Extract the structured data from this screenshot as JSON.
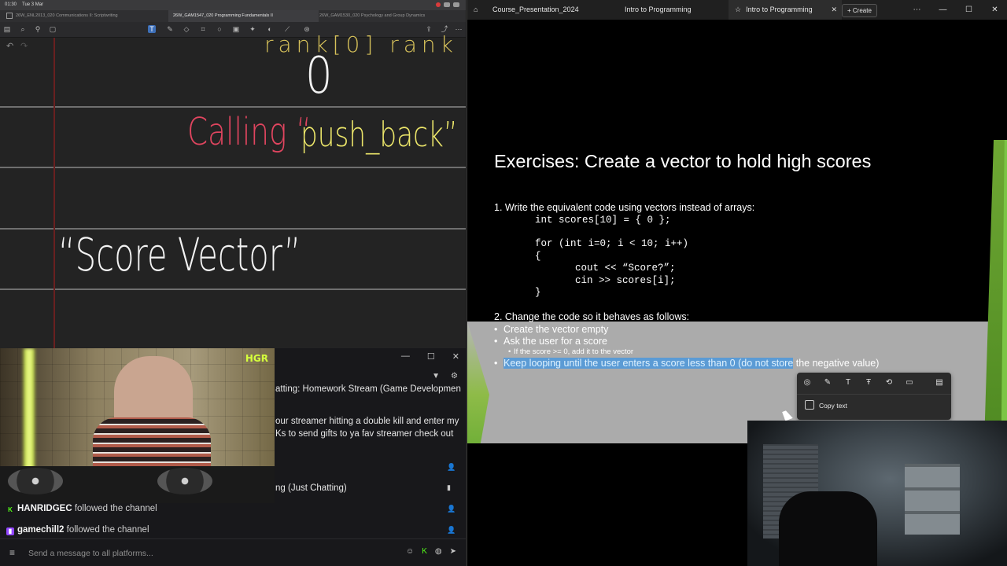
{
  "ipad": {
    "status_time": "01:30",
    "status_date": "Tue 3 Mar",
    "tabs": [
      {
        "label": "26W_ENL2013_020 Communications II: Scriptwriting"
      },
      {
        "label": "26W_GAM1547_020 Programming Fundamentals II"
      },
      {
        "label": "26W_GAM1530_020 Psychology and Group Dynamics"
      }
    ],
    "handwriting": {
      "top_partial": "rank[0] rank",
      "zero": "0",
      "calling": "Calling “",
      "push_back": "push_back”",
      "score_vector": "“Score Vector”"
    }
  },
  "chat": {
    "lines": [
      {
        "text": "atting: Homework Stream (Game Development)"
      },
      {
        "text": "our streamer hitting a double kill and enter my"
      },
      {
        "text": "Ks to send gifts to ya fav streamer check out"
      },
      {
        "text": "ng (Just Chatting)"
      }
    ],
    "follows": [
      {
        "platform": "kick",
        "user": "HANRIDGEC",
        "text": "followed the channel"
      },
      {
        "platform": "twitch",
        "user": "gamechill2",
        "text": "followed the channel"
      }
    ],
    "input_placeholder": "Send a message to all platforms...",
    "cam_logo": "HGR"
  },
  "viewer": {
    "tabs": [
      {
        "label": "Course_Presentation_2024"
      },
      {
        "label": "Intro to Programming"
      },
      {
        "label": "Intro to Programming"
      }
    ],
    "create_label": "Create"
  },
  "slide": {
    "title": "Exercises: Create a vector to hold high scores",
    "q1": "1. Write the equivalent code using vectors instead of arrays:",
    "code": [
      "int scores[10] = { 0 };",
      "for (int i=0; i < 10; i++)",
      "{",
      "cout << “Score?”;",
      "cin >> scores[i];",
      "}"
    ],
    "q2": "2. Change the code so it behaves as follows:",
    "bullets": [
      "Create the vector empty",
      "Ask the user for a score"
    ],
    "sub_bullet": "If the score >= 0, add it to the vector",
    "last_bullet_highlighted": "Keep looping until the user enters a score less than 0 (do not store",
    "last_bullet_rest": " the negative value)"
  },
  "context_menu": {
    "copy_text": "Copy text"
  },
  "colors": {
    "highlight": "#5b9bd5",
    "slide_green": "#6ea733",
    "twitch": "#9146ff",
    "kick": "#53fc18"
  }
}
